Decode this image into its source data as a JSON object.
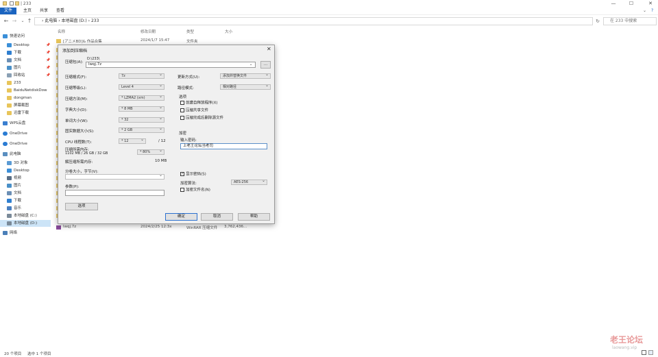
{
  "titlebar": {
    "title": "| 233",
    "min": "—",
    "max": "☐",
    "close": "✕"
  },
  "ribbon": {
    "tabs": [
      "文件",
      "主页",
      "共享",
      "查看"
    ],
    "collapse": "⌄",
    "help": "?"
  },
  "address": {
    "back": "←",
    "forward": "→",
    "recent": "⌄",
    "up": "↑",
    "path": "› 此电脑 › 本地磁盘 (D:) › 233",
    "refresh": "↻",
    "search_placeholder": "在 233 中搜索"
  },
  "nav": {
    "quick_access": "快速访问",
    "items": [
      {
        "label": "Desktop",
        "pinned": true,
        "icon": "desktop-icon",
        "color": "#3b8fd8"
      },
      {
        "label": "下载",
        "pinned": true,
        "icon": "download-icon",
        "color": "#2f7fd0"
      },
      {
        "label": "文档",
        "pinned": true,
        "icon": "document-icon",
        "color": "#6b8fb5"
      },
      {
        "label": "图片",
        "pinned": true,
        "icon": "picture-icon",
        "color": "#4a90c8"
      },
      {
        "label": "回收站",
        "pinned": true,
        "icon": "recycle-bin-icon",
        "color": "#8aa0b4"
      },
      {
        "label": "233",
        "pinned": false,
        "icon": "folder-icon",
        "color": "#e8c55a"
      },
      {
        "label": "BaiduNetdiskDow",
        "pinned": false,
        "icon": "folder-icon",
        "color": "#e8c55a"
      },
      {
        "label": "dongman",
        "pinned": false,
        "icon": "folder-icon",
        "color": "#e8c55a"
      },
      {
        "label": "屏幕截图",
        "pinned": false,
        "icon": "folder-icon",
        "color": "#e8c55a"
      },
      {
        "label": "迅雷下载",
        "pinned": false,
        "icon": "folder-icon",
        "color": "#e8c55a"
      }
    ],
    "wps": "WPS云盘",
    "onedrive1": "OneDrive",
    "onedrive2": "OneDrive",
    "this_pc": "此电脑",
    "pc_items": [
      {
        "label": "3D 对象",
        "icon": "3d-objects-icon",
        "color": "#5a9bd4"
      },
      {
        "label": "Desktop",
        "icon": "desktop-icon",
        "color": "#3b8fd8"
      },
      {
        "label": "视频",
        "icon": "video-icon",
        "color": "#5a6e85"
      },
      {
        "label": "图片",
        "icon": "picture-icon",
        "color": "#4a90c8"
      },
      {
        "label": "文档",
        "icon": "document-icon",
        "color": "#6b8fb5"
      },
      {
        "label": "下载",
        "icon": "download-icon",
        "color": "#2f7fd0"
      },
      {
        "label": "音乐",
        "icon": "music-icon",
        "color": "#4a7fc0"
      },
      {
        "label": "本地磁盘 (C:)",
        "icon": "drive-icon",
        "color": "#7a8a99"
      },
      {
        "label": "本地磁盘 (D:)",
        "icon": "drive-icon",
        "color": "#7a8a99"
      }
    ],
    "network": "网络"
  },
  "list": {
    "headers": {
      "name": "名称",
      "date": "修改日期",
      "type": "类型",
      "size": "大小"
    },
    "rows": [
      {
        "name": "[アニメBD]& 作品合集",
        "date": "2024/1/7 15:47",
        "type": "文件夹",
        "size": ""
      },
      {
        "name": "lwqj.7z",
        "date": "2024/2/25 12:3x",
        "type": "WinRAR 压缩文件",
        "size": "3,762,436..."
      }
    ],
    "partial_row_mark": "文"
  },
  "status": {
    "count": "20 个项目",
    "selected": "选中 1 个项目"
  },
  "dialog": {
    "title": "添加到压缩档",
    "close": "✕",
    "archive_label": "压缩包(A):",
    "archive_dir": "D:\\233\\",
    "archive_name": "lwqj.7z",
    "browse": "...",
    "format_label": "压缩格式(F):",
    "format_value": "7z",
    "level_label": "压缩等级(L):",
    "level_value": "Level 4",
    "method_label": "压缩方法(M):",
    "method_value": "* LZMA2 (xm)",
    "dict_label": "字典大小(D):",
    "dict_value": "* 8 MB",
    "word_label": "单词大小(W):",
    "word_value": "* 32",
    "solid_label": "固实数据大小(S):",
    "solid_value": "* 2 GB",
    "cpu_label": "CPU 线程数(T):",
    "cpu_value": "* 12",
    "cpu_total": "/ 12",
    "mem_label": "压缩所需内存:",
    "mem_detail": "1102 MB / 26 GB / 32 GB",
    "mem_value": "* 80%",
    "decomp_label": "解压缩所需内存:",
    "decomp_value": "10 MB",
    "split_label": "分卷大小，字节(V):",
    "split_value": "",
    "params_label": "参数(P):",
    "params_value": "",
    "options_button": "选项",
    "update_label": "更新方式(U):",
    "update_value": "添加并替换文件",
    "pathmode_label": "路径模式:",
    "pathmode_value": "相对路径",
    "options_group": "选项",
    "opt_sfx": "创建自释放程序(X)",
    "opt_shared": "压缩共享文件",
    "opt_delete": "压缩完成后删除源文件",
    "encrypt_group": "加密",
    "password_label": "输入密码:",
    "password_value": "上老王论坛当老司",
    "show_password": "显示密码(S)",
    "show_password_checked": "✓",
    "enc_method_label": "加密算法:",
    "enc_method_value": "AES-256",
    "encrypt_names": "加密文件名(N)",
    "ok": "确定",
    "cancel": "取消",
    "help": "帮助"
  },
  "watermark": {
    "name": "老王论坛",
    "domain": "laowang.vip"
  }
}
